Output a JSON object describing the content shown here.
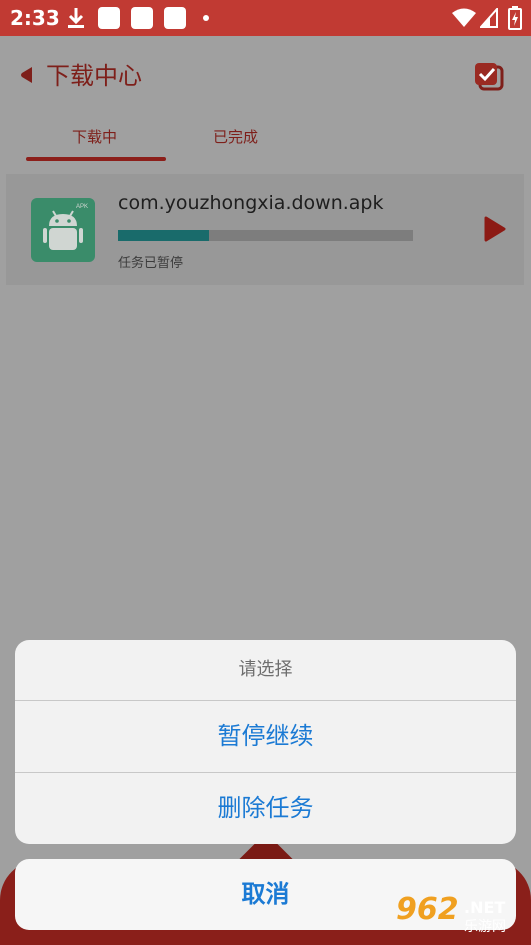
{
  "status_bar": {
    "time": "2:33",
    "icons": [
      "download-icon",
      "notification-square-icon",
      "notification-square-icon",
      "notification-square-icon",
      "dot-icon",
      "wifi-icon",
      "signal-icon",
      "battery-icon"
    ]
  },
  "header": {
    "title": "下载中心",
    "back_icon": "back-arrow-icon",
    "action_icon": "multi-select-check-icon"
  },
  "tabs": [
    {
      "label": "下载中",
      "active": true
    },
    {
      "label": "已完成",
      "active": false
    }
  ],
  "download_item": {
    "file_name": "com.youzhongxia.down.apk",
    "status": "任务已暂停",
    "progress": 0.31,
    "app_icon": "android-apk-icon",
    "action_icon": "play-icon"
  },
  "action_sheet": {
    "title": "请选择",
    "options": [
      {
        "label": "暂停继续"
      },
      {
        "label": "删除任务"
      }
    ],
    "cancel_label": "取消"
  },
  "watermark": {
    "logo": "962",
    "suffix": ".NET",
    "name": "乐游网"
  },
  "colors": {
    "status_bar": "#c13a33",
    "accent": "#7e1f1a",
    "progress_fill": "#196b6b",
    "sheet_text": "#1b7ad4",
    "overlay_background": "#a0a0a0"
  }
}
